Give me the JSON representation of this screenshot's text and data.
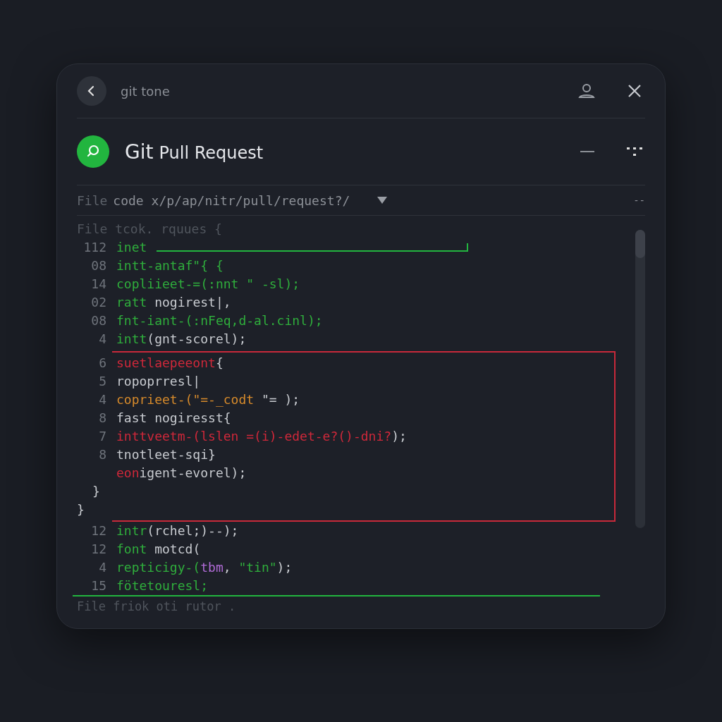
{
  "top_bar": {
    "title": "git tone"
  },
  "header": {
    "title_bold": "Git",
    "title_rest": "Pull Request"
  },
  "path_bar": {
    "label": "File",
    "path": "code x/p/ap/nitr/pull/request?/",
    "extra": "--"
  },
  "code_heading": "File tcok. rquues {",
  "blocks": [
    {
      "kind": "added",
      "lines": [
        {
          "number": "112",
          "kind": "code",
          "segments": [
            {
              "text": "inet",
              "kind": "green"
            }
          ]
        },
        {
          "number": "08",
          "segments": [
            {
              "text": "intt-antaf\"{ {",
              "kind": "green"
            }
          ]
        },
        {
          "number": "14",
          "segments": [
            {
              "text": "copliieet-=(:nnt \" -sl);",
              "kind": "green"
            }
          ]
        },
        {
          "number": "02",
          "segments": [
            {
              "text": "ratt",
              "kind": "green"
            },
            {
              "text": " nogirest|,",
              "kind": "plain"
            }
          ]
        },
        {
          "number": "08",
          "segments": [
            {
              "text": "fnt-iant-(:nFeq,d-al.cinl);",
              "kind": "green"
            }
          ]
        },
        {
          "number": "4",
          "segments": [
            {
              "text": "intt",
              "kind": "green"
            },
            {
              "text": "(gnt-scorel);",
              "kind": "plain"
            }
          ]
        }
      ]
    },
    {
      "kind": "removed",
      "lines": [
        {
          "number": "6",
          "segments": [
            {
              "text": "suetlaepeeont",
              "kind": "red"
            },
            {
              "text": "{",
              "kind": "plain"
            }
          ]
        },
        {
          "number": "5",
          "segments": [
            {
              "text": "ropoprresl|",
              "kind": "plain"
            }
          ]
        },
        {
          "number": "4",
          "segments": [
            {
              "text": "coprieet-(",
              "kind": "orange"
            },
            {
              "text": "\"=-_codt",
              "kind": "orange"
            },
            {
              "text": " \"= );",
              "kind": "plain"
            }
          ]
        },
        {
          "number": "8",
          "segments": [
            {
              "text": "fast nogiresst{",
              "kind": "plain"
            }
          ]
        },
        {
          "number": "7",
          "segments": [
            {
              "text": "inttveetm-(lslen =(i)-edet-e?()-dni?",
              "kind": "red"
            },
            {
              "text": ");",
              "kind": "plain"
            }
          ]
        },
        {
          "number": "8",
          "segments": [
            {
              "text": "tnotleet-sqi}",
              "kind": "plain"
            }
          ]
        },
        {
          "segments": [
            {
              "text": "eon",
              "kind": "red"
            },
            {
              "text": "igent-evorel);",
              "kind": "plain"
            }
          ]
        },
        {
          "kind": "inner_close",
          "segments": [
            {
              "text": "}",
              "kind": "plain"
            }
          ]
        },
        {
          "kind": "outer_close",
          "segments": [
            {
              "text": "}",
              "kind": "plain"
            }
          ]
        }
      ]
    },
    {
      "kind": "added",
      "closing": true,
      "lines": [
        {
          "number": "12",
          "segments": [
            {
              "text": "intr",
              "kind": "green"
            },
            {
              "text": "(rchel;)--);",
              "kind": "plain"
            }
          ]
        },
        {
          "number": "12",
          "segments": [
            {
              "text": "font",
              "kind": "green"
            },
            {
              "text": " motcd(",
              "kind": "plain"
            }
          ]
        },
        {
          "number": "4",
          "segments": [
            {
              "text": "repticigy-(",
              "kind": "green"
            },
            {
              "text": "tbm",
              "kind": "purple"
            },
            {
              "text": ", ",
              "kind": "plain"
            },
            {
              "text": "\"tin\"",
              "kind": "green"
            },
            {
              "text": ");",
              "kind": "plain"
            }
          ]
        },
        {
          "number": "15",
          "segments": [
            {
              "text": "fötetouresl;",
              "kind": "green"
            }
          ]
        }
      ]
    }
  ],
  "footer": "File friok oti rutor ."
}
